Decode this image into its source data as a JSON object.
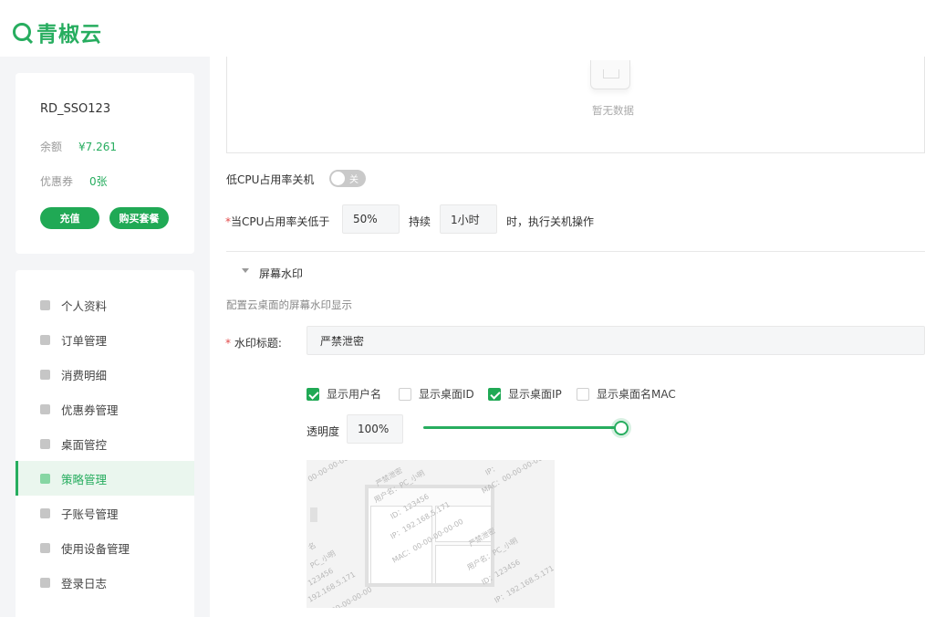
{
  "brand": {
    "name": "青椒云"
  },
  "account": {
    "username": "RD_SSO123",
    "balance_label": "余额",
    "balance_value": "¥7.261",
    "coupon_label": "优惠券",
    "coupon_value": "0张",
    "recharge_label": "充值",
    "buy_label": "购买套餐"
  },
  "nav": {
    "items": [
      {
        "label": "个人资料",
        "icon": "user-icon"
      },
      {
        "label": "订单管理",
        "icon": "order-icon"
      },
      {
        "label": "消费明细",
        "icon": "bill-icon"
      },
      {
        "label": "优惠券管理",
        "icon": "coupon-icon"
      },
      {
        "label": "桌面管控",
        "icon": "desktop-icon"
      },
      {
        "label": "策略管理",
        "icon": "list-icon",
        "active": true
      },
      {
        "label": "子账号管理",
        "icon": "sub-account-icon"
      },
      {
        "label": "使用设备管理",
        "icon": "device-grid-icon"
      },
      {
        "label": "登录日志",
        "icon": "log-icon"
      }
    ]
  },
  "empty_state": {
    "text": "暂无数据"
  },
  "low_cpu": {
    "label": "低CPU占用率关机",
    "toggle_text": "关",
    "condition_label": "当CPU占用率关低于",
    "cpu_value": "50%",
    "duration_label": "持续",
    "duration_value": "1小时",
    "action_label": "时，执行关机操作"
  },
  "watermark": {
    "section_title": "屏幕水印",
    "description": "配置云桌面的屏幕水印显示",
    "title_label": "水印标题:",
    "title_value": "严禁泄密",
    "options": [
      {
        "label": "显示用户名",
        "checked": true
      },
      {
        "label": "显示桌面ID",
        "checked": false
      },
      {
        "label": "显示桌面IP",
        "checked": true
      },
      {
        "label": "显示桌面名MAC",
        "checked": false
      }
    ],
    "opacity_label": "透明度",
    "opacity_value": "100%",
    "opacity_level": 1.0,
    "preview_texts": {
      "secret": "严禁泄密",
      "user": "用户名：PC_小明",
      "id": "ID：123456",
      "ip": "IP：192.168.5.171",
      "mac": "MAC：00-00-00-00-00",
      "pc": "PC_小明",
      "id_short": "123456",
      "ip_short": "192.168.5.171",
      "mac_short": "00-00-00-00",
      "ip_label": "IP：",
      "name_short": "名"
    }
  },
  "colors": {
    "accent": "#27ad5f",
    "required": "#e24a4a"
  }
}
